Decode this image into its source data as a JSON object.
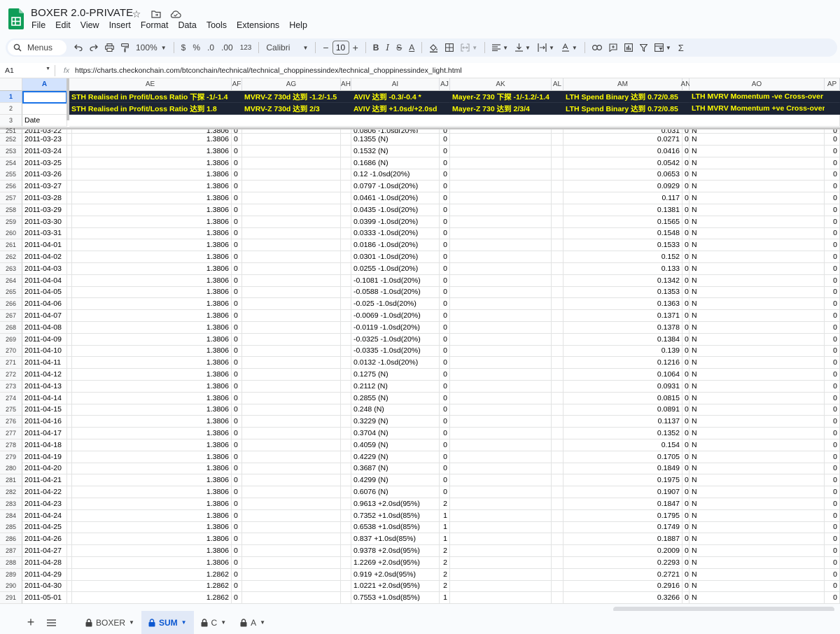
{
  "app": {
    "title": "BOXER 2.0-PRIVATE",
    "menu": [
      "File",
      "Edit",
      "View",
      "Insert",
      "Format",
      "Data",
      "Tools",
      "Extensions",
      "Help"
    ]
  },
  "toolbar": {
    "search_label": "Menus",
    "zoom": "100%",
    "currency": "$",
    "percent": "%",
    "dec_decrease": ".0",
    "dec_increase": ".00",
    "format_123": "123",
    "font": "Calibri",
    "font_size": "10",
    "minus": "−",
    "plus": "+",
    "bold": "B",
    "italic": "I",
    "strike": "S",
    "text_color": "A",
    "sigma": "Σ"
  },
  "formula_bar": {
    "cell_ref": "A1",
    "fx": "fx",
    "value": "https://charts.checkonchain.com/btconchain/technical/technical_choppinessindex/technical_choppinessindex_light.html"
  },
  "columns": [
    "A",
    "AE",
    "AF",
    "AG",
    "AH",
    "AI",
    "AJ",
    "AK",
    "AL",
    "AM",
    "AN",
    "AO",
    "AP"
  ],
  "header_rows": {
    "row_numbers": [
      "1",
      "2",
      "3"
    ],
    "row1": [
      "STH Realised in Profit/Loss Ratio 下探 -1/-1.4",
      "MVRV-Z 730d 达到 -1.2/-1.5",
      "AVIV 达到 -0.3/-0.4 *",
      "Mayer-Z 730 下探 -1/-1.2/-1.4",
      "LTH Spend Binary 达到 0.72/0.85",
      "LTH MVRV Momentum -ve Cross-over"
    ],
    "row2": [
      "STH Realised in Profit/Loss Ratio 达到 1.8",
      "MVRV-Z 730d 达到 2/3",
      "AVIV 达到 +1.0sd/+2.0sd",
      "Mayer-Z 730 达到 2/3/4",
      "LTH Spend Binary 达到 0.72/0.85",
      "LTH MVRV Momentum +ve Cross-over"
    ],
    "row3_a": "Date"
  },
  "partial_row": {
    "num": "251",
    "date": "2011-03-22",
    "ae": "1.3806",
    "af": "0",
    "ai": "0.0806 -1.0sd(20%)",
    "aj": "0",
    "am": "0.031",
    "an": "0",
    "ao": "N",
    "ap": "0"
  },
  "rows": [
    {
      "num": "252",
      "date": "2011-03-23",
      "ae": "1.3806",
      "af": "0",
      "ai": "0.1355 (N)",
      "aj": "0",
      "am": "0.0271",
      "an": "0",
      "ao": "N",
      "ap": "0"
    },
    {
      "num": "253",
      "date": "2011-03-24",
      "ae": "1.3806",
      "af": "0",
      "ai": "0.1532 (N)",
      "aj": "0",
      "am": "0.0416",
      "an": "0",
      "ao": "N",
      "ap": "0"
    },
    {
      "num": "254",
      "date": "2011-03-25",
      "ae": "1.3806",
      "af": "0",
      "ai": "0.1686 (N)",
      "aj": "0",
      "am": "0.0542",
      "an": "0",
      "ao": "N",
      "ap": "0"
    },
    {
      "num": "255",
      "date": "2011-03-26",
      "ae": "1.3806",
      "af": "0",
      "ai": "0.12 -1.0sd(20%)",
      "aj": "0",
      "am": "0.0653",
      "an": "0",
      "ao": "N",
      "ap": "0"
    },
    {
      "num": "256",
      "date": "2011-03-27",
      "ae": "1.3806",
      "af": "0",
      "ai": "0.0797 -1.0sd(20%)",
      "aj": "0",
      "am": "0.0929",
      "an": "0",
      "ao": "N",
      "ap": "0"
    },
    {
      "num": "257",
      "date": "2011-03-28",
      "ae": "1.3806",
      "af": "0",
      "ai": "0.0461 -1.0sd(20%)",
      "aj": "0",
      "am": "0.117",
      "an": "0",
      "ao": "N",
      "ap": "0"
    },
    {
      "num": "258",
      "date": "2011-03-29",
      "ae": "1.3806",
      "af": "0",
      "ai": "0.0435 -1.0sd(20%)",
      "aj": "0",
      "am": "0.1381",
      "an": "0",
      "ao": "N",
      "ap": "0"
    },
    {
      "num": "259",
      "date": "2011-03-30",
      "ae": "1.3806",
      "af": "0",
      "ai": "0.0399 -1.0sd(20%)",
      "aj": "0",
      "am": "0.1565",
      "an": "0",
      "ao": "N",
      "ap": "0"
    },
    {
      "num": "260",
      "date": "2011-03-31",
      "ae": "1.3806",
      "af": "0",
      "ai": "0.0333 -1.0sd(20%)",
      "aj": "0",
      "am": "0.1548",
      "an": "0",
      "ao": "N",
      "ap": "0"
    },
    {
      "num": "261",
      "date": "2011-04-01",
      "ae": "1.3806",
      "af": "0",
      "ai": "0.0186 -1.0sd(20%)",
      "aj": "0",
      "am": "0.1533",
      "an": "0",
      "ao": "N",
      "ap": "0"
    },
    {
      "num": "262",
      "date": "2011-04-02",
      "ae": "1.3806",
      "af": "0",
      "ai": "0.0301 -1.0sd(20%)",
      "aj": "0",
      "am": "0.152",
      "an": "0",
      "ao": "N",
      "ap": "0"
    },
    {
      "num": "263",
      "date": "2011-04-03",
      "ae": "1.3806",
      "af": "0",
      "ai": "0.0255 -1.0sd(20%)",
      "aj": "0",
      "am": "0.133",
      "an": "0",
      "ao": "N",
      "ap": "0"
    },
    {
      "num": "264",
      "date": "2011-04-04",
      "ae": "1.3806",
      "af": "0",
      "ai": "-0.1081 -1.0sd(20%)",
      "aj": "0",
      "am": "0.1342",
      "an": "0",
      "ao": "N",
      "ap": "0"
    },
    {
      "num": "265",
      "date": "2011-04-05",
      "ae": "1.3806",
      "af": "0",
      "ai": "-0.0588 -1.0sd(20%)",
      "aj": "0",
      "am": "0.1353",
      "an": "0",
      "ao": "N",
      "ap": "0"
    },
    {
      "num": "266",
      "date": "2011-04-06",
      "ae": "1.3806",
      "af": "0",
      "ai": "-0.025 -1.0sd(20%)",
      "aj": "0",
      "am": "0.1363",
      "an": "0",
      "ao": "N",
      "ap": "0"
    },
    {
      "num": "267",
      "date": "2011-04-07",
      "ae": "1.3806",
      "af": "0",
      "ai": "-0.0069 -1.0sd(20%)",
      "aj": "0",
      "am": "0.1371",
      "an": "0",
      "ao": "N",
      "ap": "0"
    },
    {
      "num": "268",
      "date": "2011-04-08",
      "ae": "1.3806",
      "af": "0",
      "ai": "-0.0119 -1.0sd(20%)",
      "aj": "0",
      "am": "0.1378",
      "an": "0",
      "ao": "N",
      "ap": "0"
    },
    {
      "num": "269",
      "date": "2011-04-09",
      "ae": "1.3806",
      "af": "0",
      "ai": "-0.0325 -1.0sd(20%)",
      "aj": "0",
      "am": "0.1384",
      "an": "0",
      "ao": "N",
      "ap": "0"
    },
    {
      "num": "270",
      "date": "2011-04-10",
      "ae": "1.3806",
      "af": "0",
      "ai": "-0.0335 -1.0sd(20%)",
      "aj": "0",
      "am": "0.139",
      "an": "0",
      "ao": "N",
      "ap": "0"
    },
    {
      "num": "271",
      "date": "2011-04-11",
      "ae": "1.3806",
      "af": "0",
      "ai": "0.0132 -1.0sd(20%)",
      "aj": "0",
      "am": "0.1216",
      "an": "0",
      "ao": "N",
      "ap": "0"
    },
    {
      "num": "272",
      "date": "2011-04-12",
      "ae": "1.3806",
      "af": "0",
      "ai": "0.1275 (N)",
      "aj": "0",
      "am": "0.1064",
      "an": "0",
      "ao": "N",
      "ap": "0"
    },
    {
      "num": "273",
      "date": "2011-04-13",
      "ae": "1.3806",
      "af": "0",
      "ai": "0.2112 (N)",
      "aj": "0",
      "am": "0.0931",
      "an": "0",
      "ao": "N",
      "ap": "0"
    },
    {
      "num": "274",
      "date": "2011-04-14",
      "ae": "1.3806",
      "af": "0",
      "ai": "0.2855 (N)",
      "aj": "0",
      "am": "0.0815",
      "an": "0",
      "ao": "N",
      "ap": "0"
    },
    {
      "num": "275",
      "date": "2011-04-15",
      "ae": "1.3806",
      "af": "0",
      "ai": "0.248 (N)",
      "aj": "0",
      "am": "0.0891",
      "an": "0",
      "ao": "N",
      "ap": "0"
    },
    {
      "num": "276",
      "date": "2011-04-16",
      "ae": "1.3806",
      "af": "0",
      "ai": "0.3229 (N)",
      "aj": "0",
      "am": "0.1137",
      "an": "0",
      "ao": "N",
      "ap": "0"
    },
    {
      "num": "277",
      "date": "2011-04-17",
      "ae": "1.3806",
      "af": "0",
      "ai": "0.3704 (N)",
      "aj": "0",
      "am": "0.1352",
      "an": "0",
      "ao": "N",
      "ap": "0"
    },
    {
      "num": "278",
      "date": "2011-04-18",
      "ae": "1.3806",
      "af": "0",
      "ai": "0.4059 (N)",
      "aj": "0",
      "am": "0.154",
      "an": "0",
      "ao": "N",
      "ap": "0"
    },
    {
      "num": "279",
      "date": "2011-04-19",
      "ae": "1.3806",
      "af": "0",
      "ai": "0.4229 (N)",
      "aj": "0",
      "am": "0.1705",
      "an": "0",
      "ao": "N",
      "ap": "0"
    },
    {
      "num": "280",
      "date": "2011-04-20",
      "ae": "1.3806",
      "af": "0",
      "ai": "0.3687 (N)",
      "aj": "0",
      "am": "0.1849",
      "an": "0",
      "ao": "N",
      "ap": "0"
    },
    {
      "num": "281",
      "date": "2011-04-21",
      "ae": "1.3806",
      "af": "0",
      "ai": "0.4299 (N)",
      "aj": "0",
      "am": "0.1975",
      "an": "0",
      "ao": "N",
      "ap": "0"
    },
    {
      "num": "282",
      "date": "2011-04-22",
      "ae": "1.3806",
      "af": "0",
      "ai": "0.6076 (N)",
      "aj": "0",
      "am": "0.1907",
      "an": "0",
      "ao": "N",
      "ap": "0"
    },
    {
      "num": "283",
      "date": "2011-04-23",
      "ae": "1.3806",
      "af": "0",
      "ai": "0.9613 +2.0sd(95%)",
      "aj": "2",
      "am": "0.1847",
      "an": "0",
      "ao": "N",
      "ap": "0"
    },
    {
      "num": "284",
      "date": "2011-04-24",
      "ae": "1.3806",
      "af": "0",
      "ai": "0.7352 +1.0sd(85%)",
      "aj": "1",
      "am": "0.1795",
      "an": "0",
      "ao": "N",
      "ap": "0"
    },
    {
      "num": "285",
      "date": "2011-04-25",
      "ae": "1.3806",
      "af": "0",
      "ai": "0.6538 +1.0sd(85%)",
      "aj": "1",
      "am": "0.1749",
      "an": "0",
      "ao": "N",
      "ap": "0"
    },
    {
      "num": "286",
      "date": "2011-04-26",
      "ae": "1.3806",
      "af": "0",
      "ai": "0.837 +1.0sd(85%)",
      "aj": "1",
      "am": "0.1887",
      "an": "0",
      "ao": "N",
      "ap": "0"
    },
    {
      "num": "287",
      "date": "2011-04-27",
      "ae": "1.3806",
      "af": "0",
      "ai": "0.9378 +2.0sd(95%)",
      "aj": "2",
      "am": "0.2009",
      "an": "0",
      "ao": "N",
      "ap": "0"
    },
    {
      "num": "288",
      "date": "2011-04-28",
      "ae": "1.3806",
      "af": "0",
      "ai": "1.2269 +2.0sd(95%)",
      "aj": "2",
      "am": "0.2293",
      "an": "0",
      "ao": "N",
      "ap": "0"
    },
    {
      "num": "289",
      "date": "2011-04-29",
      "ae": "1.2862",
      "af": "0",
      "ai": "0.919 +2.0sd(95%)",
      "aj": "2",
      "am": "0.2721",
      "an": "0",
      "ao": "N",
      "ap": "0"
    },
    {
      "num": "290",
      "date": "2011-04-30",
      "ae": "1.2862",
      "af": "0",
      "ai": "1.0221 +2.0sd(95%)",
      "aj": "2",
      "am": "0.2916",
      "an": "0",
      "ao": "N",
      "ap": "0"
    },
    {
      "num": "291",
      "date": "2011-05-01",
      "ae": "1.2862",
      "af": "0",
      "ai": "0.7553 +1.0sd(85%)",
      "aj": "1",
      "am": "0.3266",
      "an": "0",
      "ao": "N",
      "ap": "0"
    }
  ],
  "sheets": [
    {
      "name": "BOXER",
      "locked": true,
      "active": false
    },
    {
      "name": "SUM",
      "locked": true,
      "active": true
    },
    {
      "name": "C",
      "locked": true,
      "active": false
    },
    {
      "name": "A",
      "locked": true,
      "active": false
    }
  ],
  "colors": {
    "header_bg": "#1c2434",
    "header_text": "#ffff00",
    "accent": "#0b57d0",
    "sheets_green": "#0f9d58"
  }
}
